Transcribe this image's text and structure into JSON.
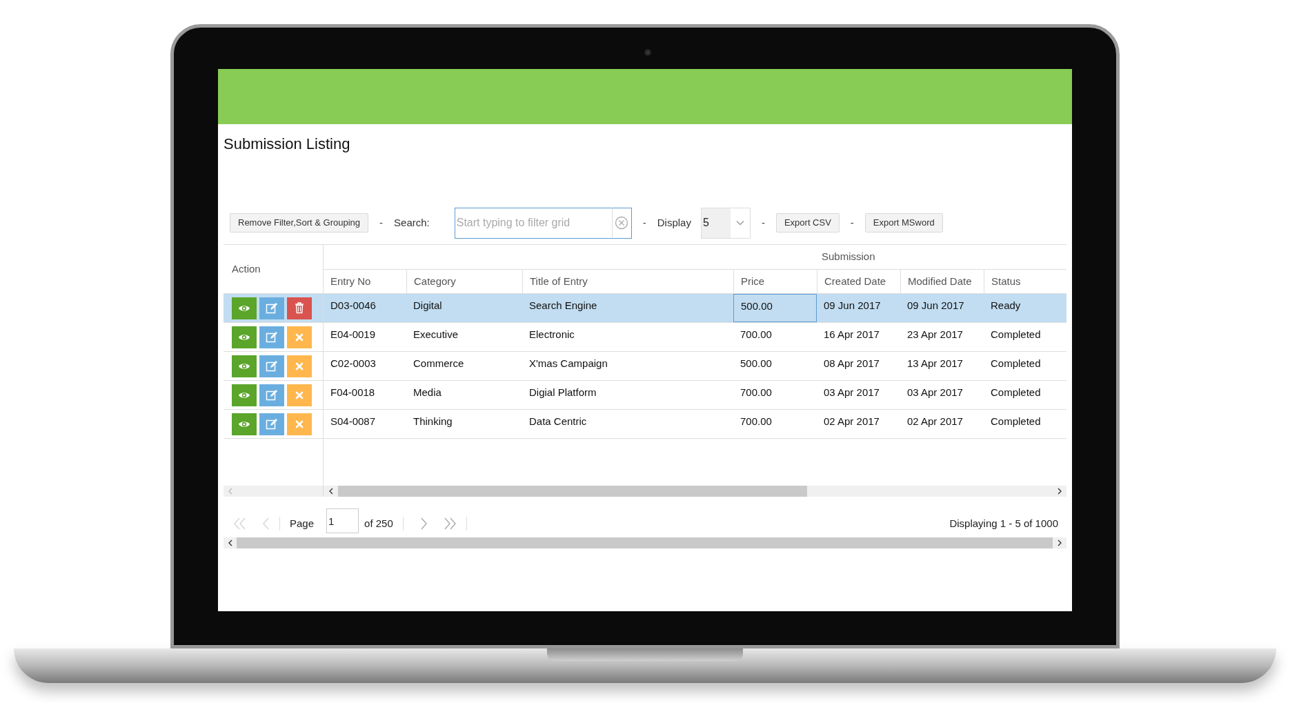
{
  "title": "Submission Listing",
  "toolbar": [
    {
      "kind": "button",
      "text": "Remove Filter,Sort & Grouping"
    },
    {
      "kind": "separator",
      "text": "-"
    },
    {
      "kind": "label",
      "text": "Search:"
    },
    {
      "kind": "search",
      "placeholder": "Start typing to filter grid"
    },
    {
      "kind": "separator",
      "text": "-"
    },
    {
      "kind": "label",
      "text": "Display"
    },
    {
      "kind": "select",
      "value": "5"
    },
    {
      "kind": "separator",
      "text": "-"
    },
    {
      "kind": "button",
      "text": "Export CSV"
    },
    {
      "kind": "separator",
      "text": "-"
    },
    {
      "kind": "button",
      "text": "Export MSword"
    }
  ],
  "grid": {
    "action_header": "Action",
    "group_header": "Submission",
    "columns": [
      "Entry No",
      "Category",
      "Title of Entry",
      "Price",
      "Created Date",
      "Modified Date",
      "Status"
    ],
    "rows": [
      {
        "selected": true,
        "actions": [
          {
            "kind": "view"
          },
          {
            "kind": "edit"
          },
          {
            "kind": "delete"
          }
        ],
        "cells": [
          "D03-0046",
          "Digital",
          "Search Engine",
          "500.00",
          "09 Jun 2017",
          "09 Jun 2017",
          "Ready"
        ]
      },
      {
        "selected": false,
        "actions": [
          {
            "kind": "view"
          },
          {
            "kind": "edit"
          },
          {
            "kind": "cancel"
          }
        ],
        "cells": [
          "E04-0019",
          "Executive",
          "Electronic",
          "700.00",
          "16 Apr 2017",
          "23 Apr 2017",
          "Completed"
        ]
      },
      {
        "selected": false,
        "actions": [
          {
            "kind": "view"
          },
          {
            "kind": "edit"
          },
          {
            "kind": "cancel"
          }
        ],
        "cells": [
          "C02-0003",
          "Commerce",
          "X'mas Campaign",
          "500.00",
          "08 Apr 2017",
          "13 Apr 2017",
          "Completed"
        ]
      },
      {
        "selected": false,
        "actions": [
          {
            "kind": "view"
          },
          {
            "kind": "edit"
          },
          {
            "kind": "cancel"
          }
        ],
        "cells": [
          "F04-0018",
          "Media",
          "Digial Platform",
          "700.00",
          "03 Apr 2017",
          "03 Apr 2017",
          "Completed"
        ]
      },
      {
        "selected": false,
        "actions": [
          {
            "kind": "view"
          },
          {
            "kind": "edit"
          },
          {
            "kind": "cancel"
          }
        ],
        "cells": [
          "S04-0087",
          "Thinking",
          "Data Centric",
          "700.00",
          "02 Apr 2017",
          "02 Apr 2017",
          "Completed"
        ]
      }
    ]
  },
  "pager": {
    "page_label": "Page",
    "page": "1",
    "page_count": "of 250",
    "summary": "Displaying 1 - 5 of 1000"
  }
}
